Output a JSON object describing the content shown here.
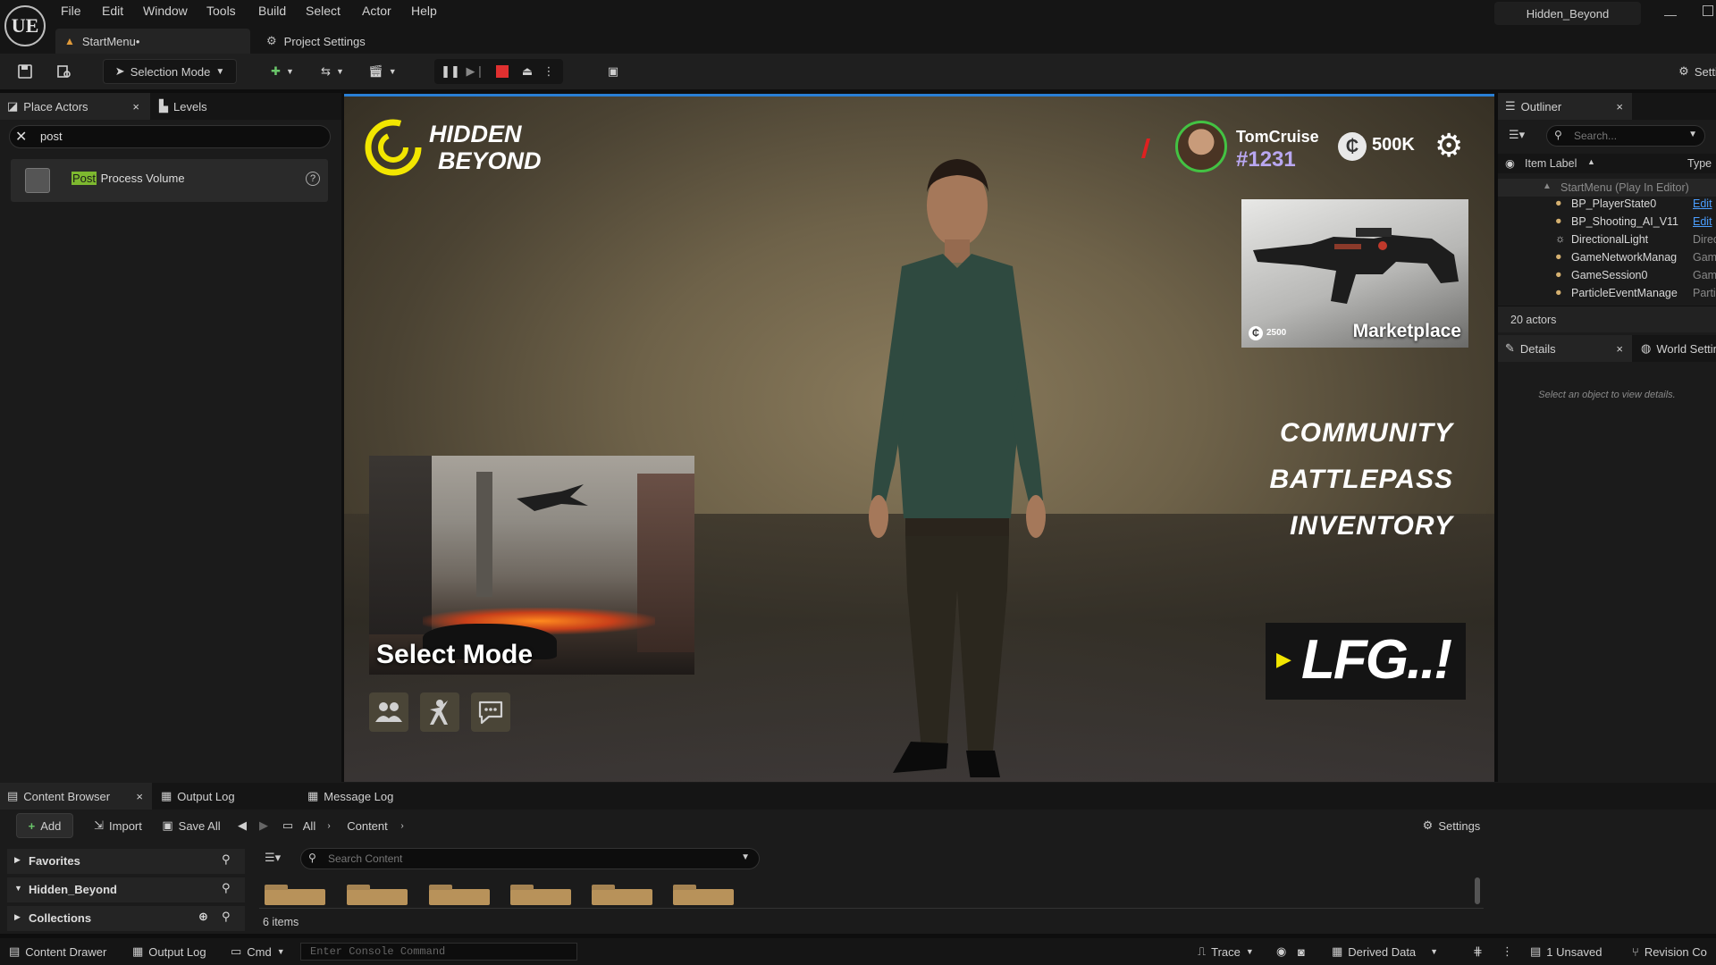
{
  "app": {
    "logo": "UE",
    "menus": [
      "File",
      "Edit",
      "Window",
      "Tools",
      "Build",
      "Select",
      "Actor",
      "Help"
    ],
    "project_name": "Hidden_Beyond",
    "tabs": [
      {
        "label": "StartMenu•"
      },
      {
        "label": "Project Settings"
      }
    ],
    "toolbar": {
      "mode_label": "Selection Mode",
      "settings_label": "Setti"
    }
  },
  "left_panel": {
    "tabs": [
      {
        "label": "Place Actors"
      },
      {
        "label": "Levels"
      }
    ],
    "search_value": "post",
    "results": [
      {
        "highlight": "Post",
        "rest": " Process Volume"
      }
    ]
  },
  "viewport": {
    "game_title_line1": "HIDDEN",
    "game_title_line2": "BEYOND",
    "player_name": "TomCruise",
    "player_tag": "#1231",
    "currency_symbol": "₵",
    "currency_amount": "500K",
    "marketplace": {
      "label": "Marketplace",
      "price": "2500"
    },
    "menu_items": [
      "COMMUNITY",
      "BATTLEPASS",
      "INVENTORY"
    ],
    "select_mode_label": "Select Mode",
    "lfg_label": "LFG..!",
    "accent_color": "#f2e600"
  },
  "outliner": {
    "title": "Outliner",
    "search_placeholder": "Search...",
    "col_item_label": "Item Label",
    "col_type": "Type",
    "root": "StartMenu (Play In Editor)",
    "rows": [
      {
        "label": "BP_PlayerState0",
        "type": "Edit"
      },
      {
        "label": "BP_Shooting_AI_V11",
        "type": "Edit"
      },
      {
        "label": "DirectionalLight",
        "type": "Direc"
      },
      {
        "label": "GameNetworkManag",
        "type": "Gam"
      },
      {
        "label": "GameSession0",
        "type": "Gam"
      },
      {
        "label": "ParticleEventManage",
        "type": "Parti"
      }
    ],
    "actor_count": "20 actors"
  },
  "details": {
    "tabs": [
      {
        "label": "Details"
      },
      {
        "label": "World Settin"
      }
    ],
    "empty_msg": "Select an object to view details."
  },
  "content_browser": {
    "tabs": [
      {
        "label": "Content Browser"
      },
      {
        "label": "Output Log"
      },
      {
        "label": "Message Log"
      }
    ],
    "add_label": "Add",
    "import_label": "Import",
    "save_all_label": "Save All",
    "crumbs": [
      "All",
      "Content"
    ],
    "settings_label": "Settings",
    "tree": [
      {
        "label": "Favorites"
      },
      {
        "label": "Hidden_Beyond"
      },
      {
        "label": "Collections"
      }
    ],
    "search_placeholder": "Search Content",
    "item_count": "6 items"
  },
  "statusbar": {
    "content_drawer": "Content Drawer",
    "output_log": "Output Log",
    "cmd": "Cmd",
    "console_placeholder": "Enter Console Command",
    "trace": "Trace",
    "derived_data": "Derived Data",
    "unsaved": "1 Unsaved",
    "revision": "Revision Co"
  }
}
